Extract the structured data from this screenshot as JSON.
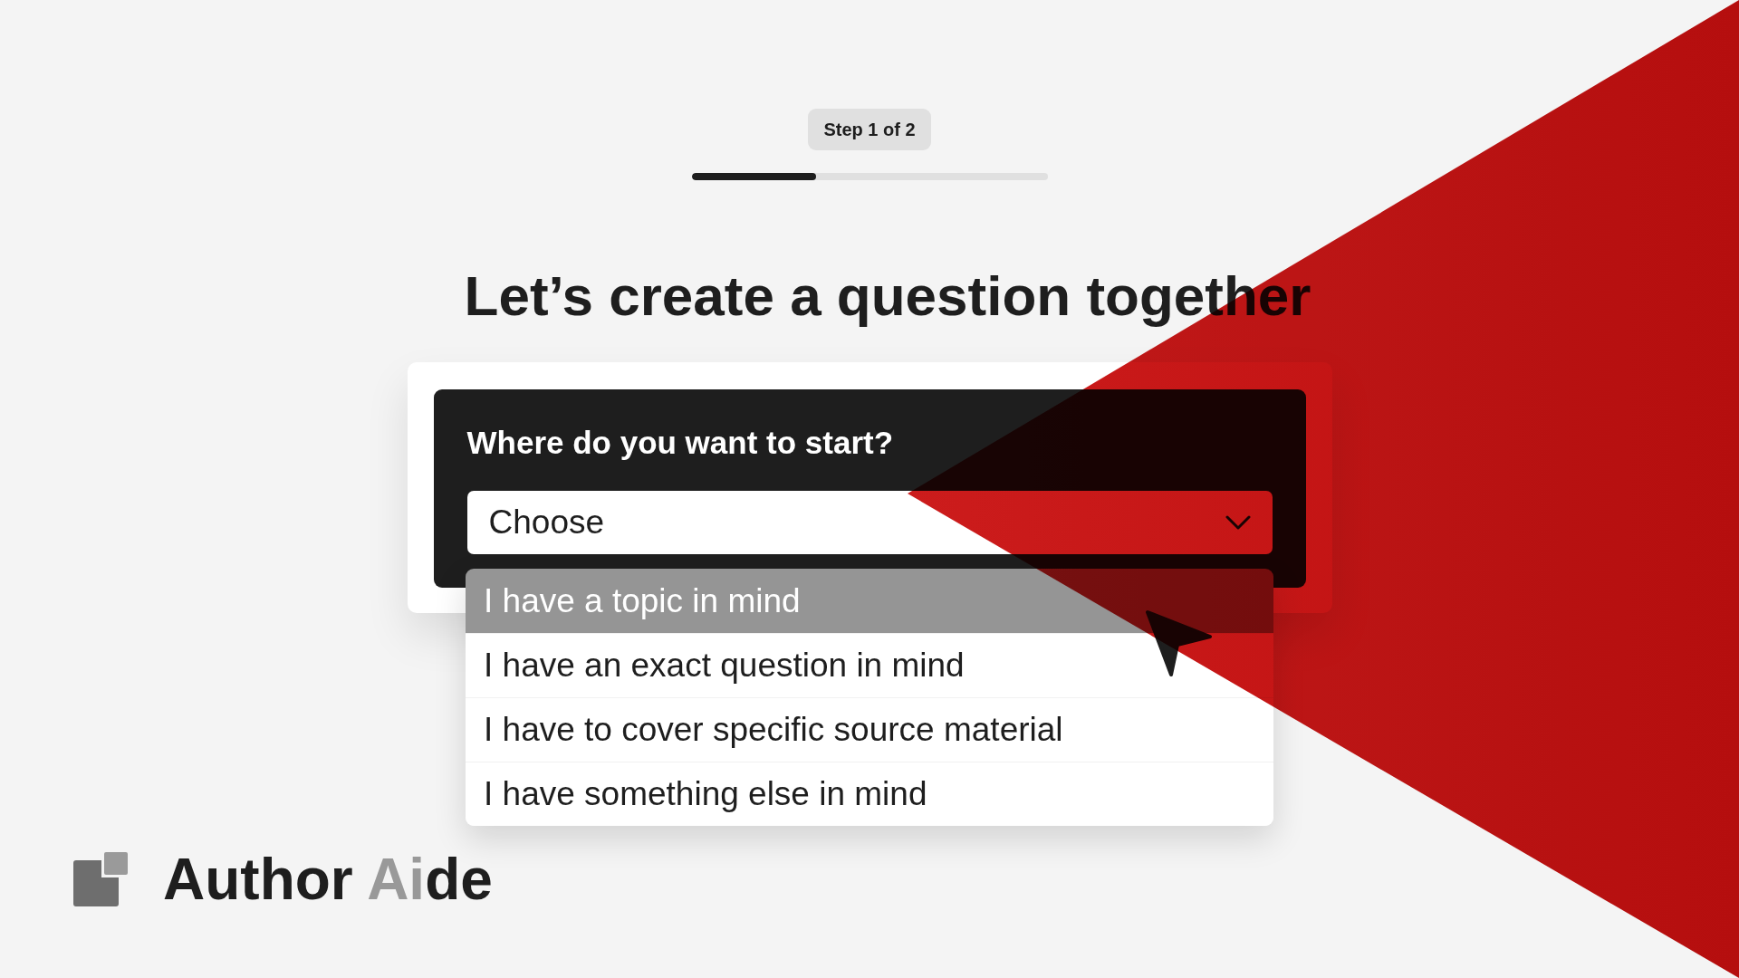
{
  "step_badge": "Step 1 of 2",
  "progress": {
    "level": 0.35
  },
  "heading": "Let’s create a question together",
  "question": {
    "label": "Where do you want to start?",
    "dropdown": {
      "placeholder": "Choose",
      "options": [
        {
          "label": "I have a topic in mind",
          "selected": true
        },
        {
          "label": "I have an exact question in mind",
          "selected": false
        },
        {
          "label": "I have to cover specific source material",
          "selected": false
        },
        {
          "label": "I have something else in mind",
          "selected": false
        }
      ]
    }
  },
  "brand": {
    "wordmark": [
      {
        "text": "Author ",
        "accent": false
      },
      {
        "text": "Ai",
        "accent": true
      },
      {
        "text": "de",
        "accent": false
      }
    ]
  }
}
